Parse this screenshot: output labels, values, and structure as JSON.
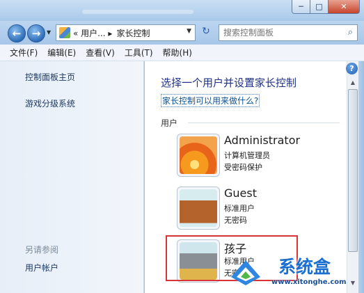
{
  "window": {
    "minimize_glyph": "─",
    "maximize_glyph": "□",
    "close_glyph": "✕"
  },
  "address": {
    "segment_parent": "« 用户... ▸",
    "segment_current": "家长控制"
  },
  "search": {
    "placeholder": "搜索控制面板"
  },
  "menu": [
    "文件(F)",
    "编辑(E)",
    "查看(V)",
    "工具(T)",
    "帮助(H)"
  ],
  "sidebar": {
    "home": "控制面板主页",
    "ratings": "游戏分级系统",
    "see_also": "另请参阅",
    "user_accounts": "用户帐户"
  },
  "main": {
    "heading": "选择一个用户并设置家长控制",
    "help_link": "家长控制可以用来做什么?",
    "section": "用户",
    "users": [
      {
        "name": "Administrator",
        "role": "计算机管理员",
        "password": "受密码保护",
        "picture": "flower"
      },
      {
        "name": "Guest",
        "role": "标准用户",
        "password": "无密码",
        "picture": "suitcase"
      },
      {
        "name": "孩子",
        "role": "标准用户",
        "password": "无密码",
        "picture": "robot"
      }
    ]
  },
  "watermark": {
    "brand": "系统盒",
    "url": "www.xitonghe.com"
  },
  "colors": {
    "highlight": "#d9333a",
    "heading": "#1e3287",
    "link": "#0b5394"
  }
}
